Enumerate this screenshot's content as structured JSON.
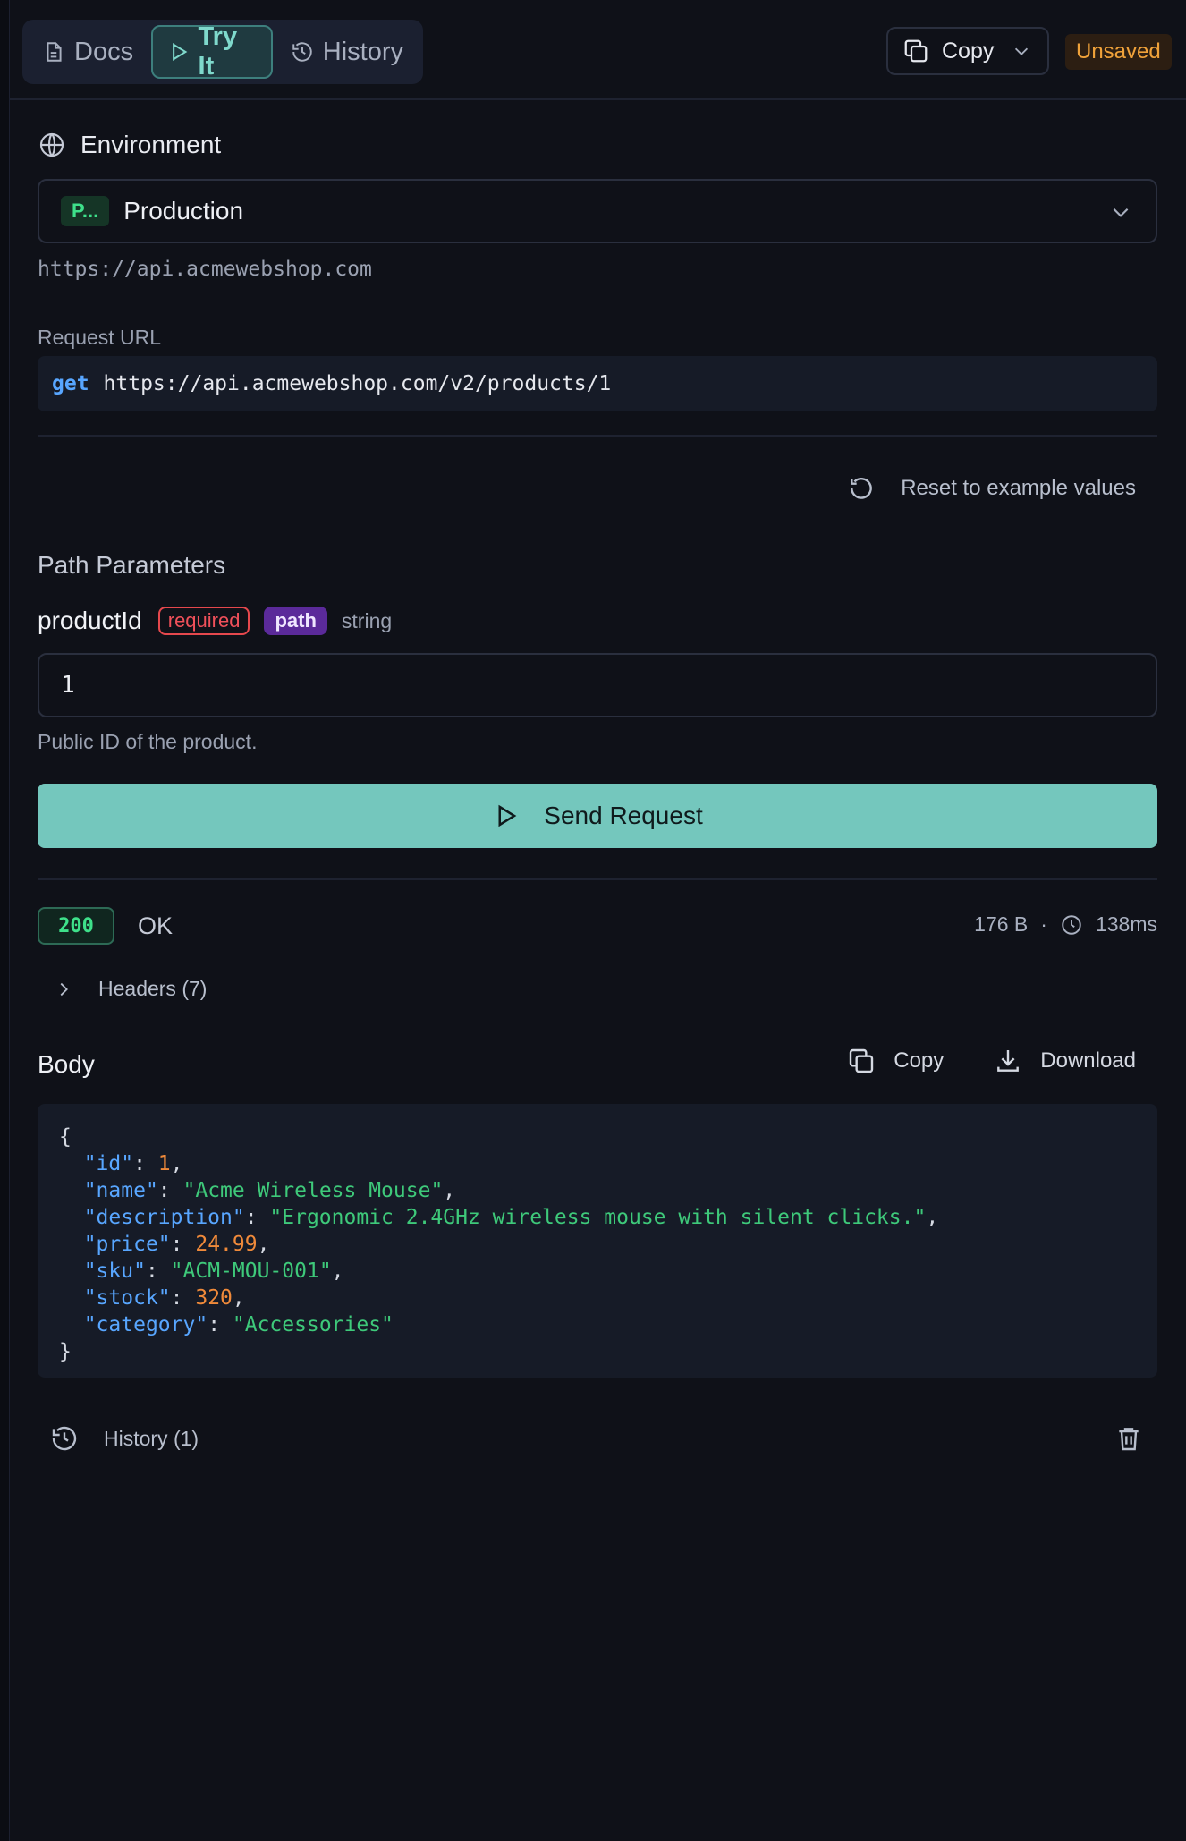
{
  "tabs": [
    {
      "label": "Docs",
      "icon": "document-icon"
    },
    {
      "label": "Try It",
      "icon": "play-icon",
      "active": true
    },
    {
      "label": "History",
      "icon": "history-icon"
    }
  ],
  "toolbar": {
    "copy_label": "Copy",
    "unsaved_label": "Unsaved"
  },
  "environment": {
    "heading": "Environment",
    "badge": "P...",
    "selected": "Production",
    "base_url": "https://api.acmewebshop.com"
  },
  "request": {
    "label": "Request URL",
    "method": "get",
    "url": "https://api.acmewebshop.com/v2/products/1"
  },
  "reset_label": "Reset to example values",
  "path_params": {
    "title": "Path Parameters",
    "params": [
      {
        "name": "productId",
        "required_label": "required",
        "location": "path",
        "type": "string",
        "value": "1",
        "description": "Public ID of the product."
      }
    ]
  },
  "send_label": "Send Request",
  "response": {
    "status_code": "200",
    "status_text": "OK",
    "size": "176 B",
    "separator": "·",
    "time": "138ms",
    "headers_label": "Headers (7)",
    "body_title": "Body",
    "copy_label": "Copy",
    "download_label": "Download",
    "body": [
      {
        "key": "id",
        "value": "1",
        "kind": "number"
      },
      {
        "key": "name",
        "value": "Acme Wireless Mouse",
        "kind": "string"
      },
      {
        "key": "description",
        "value": "Ergonomic 2.4GHz wireless mouse with silent clicks.",
        "kind": "string"
      },
      {
        "key": "price",
        "value": "24.99",
        "kind": "number"
      },
      {
        "key": "sku",
        "value": "ACM-MOU-001",
        "kind": "string"
      },
      {
        "key": "stock",
        "value": "320",
        "kind": "number"
      },
      {
        "key": "category",
        "value": "Accessories",
        "kind": "string"
      }
    ]
  },
  "history_label": "History (1)",
  "colors": {
    "accent": "#74c7bd",
    "success": "#3ee08a",
    "warning": "#f0a23a",
    "danger": "#e5484d",
    "path": "#5b2a9a"
  }
}
